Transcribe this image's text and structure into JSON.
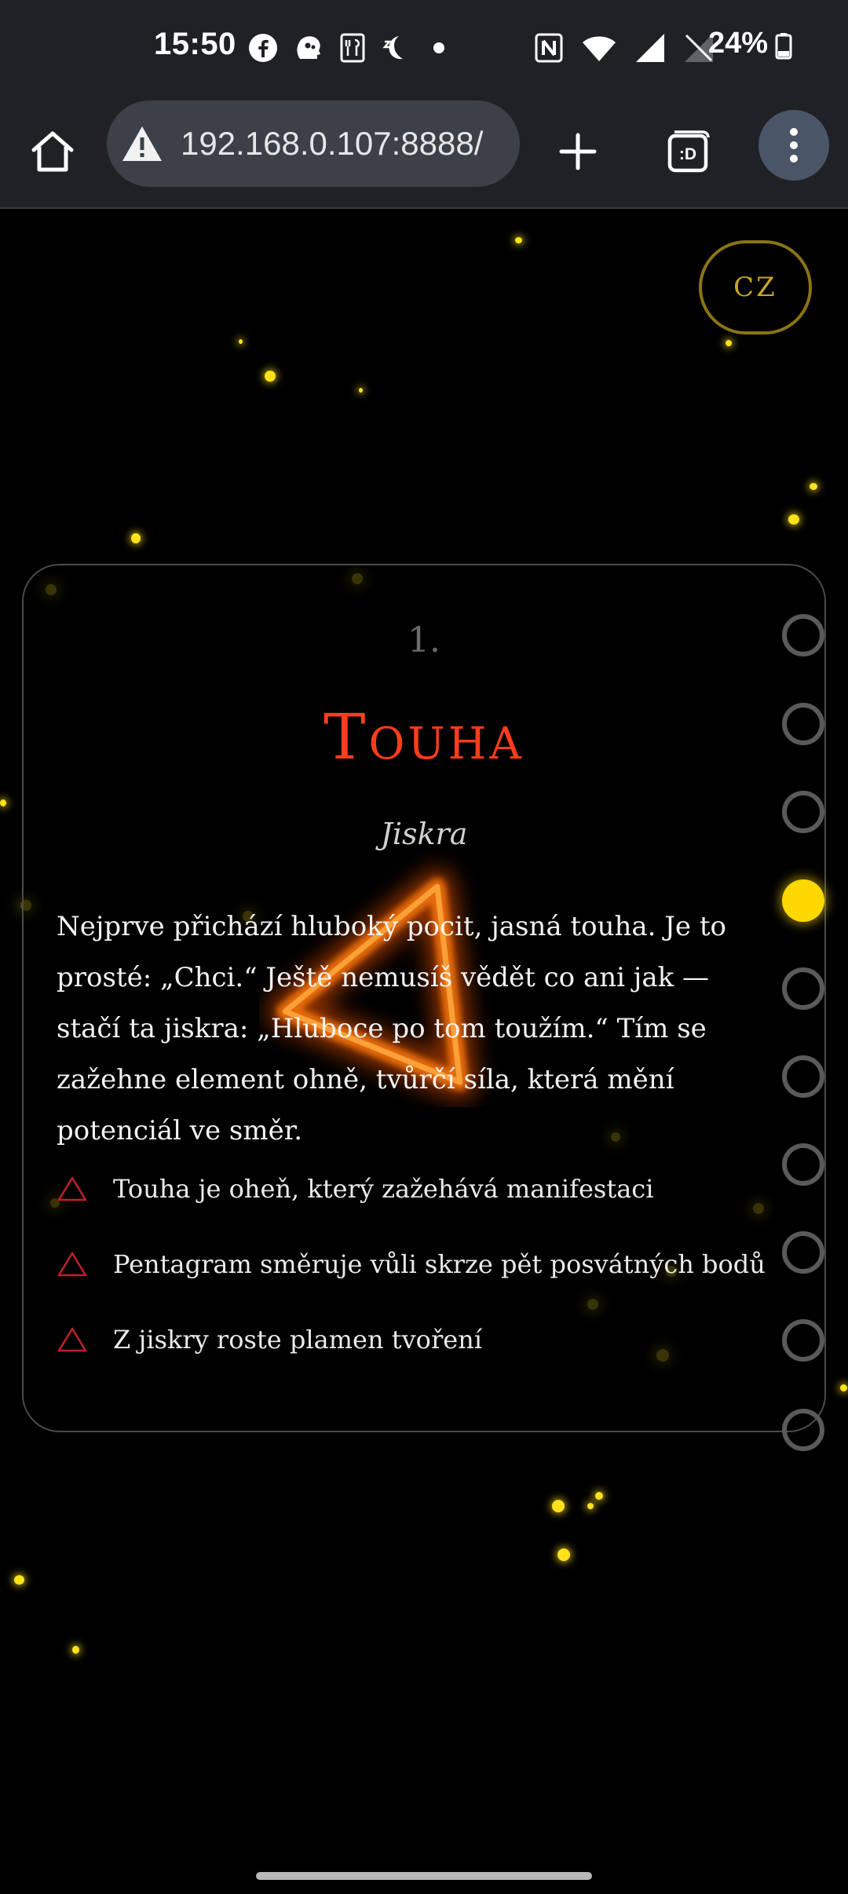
{
  "status_bar": {
    "time": "15:50",
    "battery": "24%",
    "notification_icons": [
      "facebook-icon",
      "assistant-icon",
      "sim-tray-icon",
      "sleep-icon",
      "dot-icon"
    ],
    "system_icons": [
      "nfc-icon",
      "wifi-icon",
      "signal-icon",
      "signal-empty-icon",
      "battery-icon"
    ]
  },
  "browser": {
    "url": "192.168.0.107:8888/",
    "icons": {
      "home": "home-icon",
      "security": "warning-triangle-icon",
      "new_tab": "plus-icon",
      "tabs": "tab-switcher-icon",
      "menu": "more-vert-icon"
    },
    "tab_switcher_label": ":D"
  },
  "page": {
    "language_button": "CZ",
    "card": {
      "number": "1.",
      "title": "Touha",
      "subtitle": "Jiskra",
      "body": "Nejprve přichází hluboký pocit, jasná touha. Je to prosté: „Chci.“ Ještě nemusíš vědět co ani jak — stačí ta jiskra: „Hluboce po tom toužím.“ Tím se zažehne element ohně, tvůrčí síla, která mění potenciál ve směr.",
      "bullets": [
        "Touha je oheň, který zažehává manifestaci",
        "Pentagram směruje vůli skrze pět posvátných bodů",
        "Z jiskry roste plamen tvoření"
      ]
    },
    "steps": {
      "count": 10,
      "active_index": 3
    },
    "colors": {
      "title": "#ff3d1a",
      "accent_gold": "#ffd800",
      "spark": "#ffe21a",
      "bullet_icon": "#c0202a",
      "lang_border": "#8a7414"
    }
  }
}
